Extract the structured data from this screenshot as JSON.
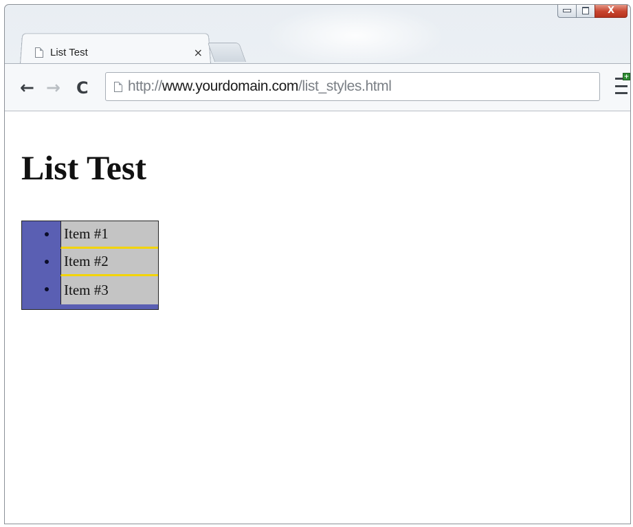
{
  "window": {
    "controls": [
      "minimize",
      "maximize",
      "close"
    ],
    "close_label": "X"
  },
  "tabs": [
    {
      "title": "List Test",
      "close_glyph": "×",
      "icon": "page-icon"
    }
  ],
  "toolbar": {
    "back_glyph": "←",
    "forward_glyph": "→",
    "reload_glyph": "C",
    "url_scheme": "http://",
    "url_host": "www.yourdomain.com",
    "url_path": "/list_styles.html",
    "menu_icon": "menu-icon"
  },
  "page": {
    "heading": "List Test",
    "list_items": [
      "Item #1",
      "Item #2",
      "Item #3"
    ]
  },
  "colors": {
    "list_background": "#5a5fb3",
    "item_background": "#c4c4c4",
    "item_border": "#f3d400"
  }
}
